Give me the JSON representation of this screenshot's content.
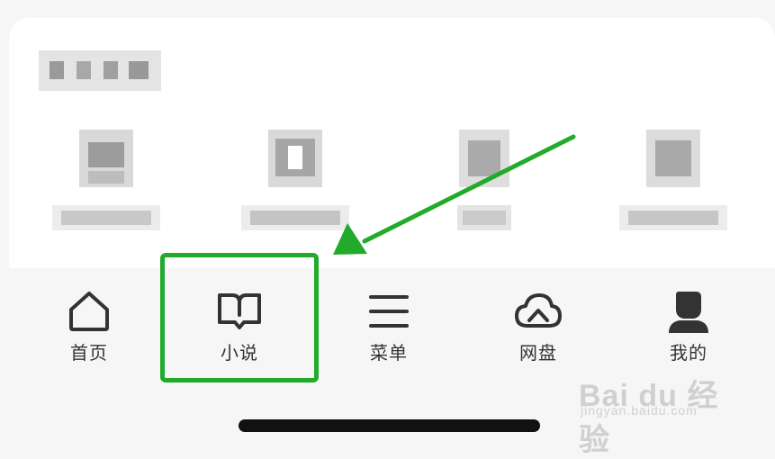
{
  "tabs": [
    {
      "label": "首页",
      "icon": "home-icon"
    },
    {
      "label": "小说",
      "icon": "book-icon"
    },
    {
      "label": "菜单",
      "icon": "menu-icon"
    },
    {
      "label": "网盘",
      "icon": "cloud-icon"
    },
    {
      "label": "我的",
      "icon": "user-icon"
    }
  ],
  "highlight": {
    "target": "小说",
    "color": "#22aa2a"
  },
  "watermark": {
    "brand": "Bai du 经验",
    "sub": "jingyan.baidu.com"
  }
}
